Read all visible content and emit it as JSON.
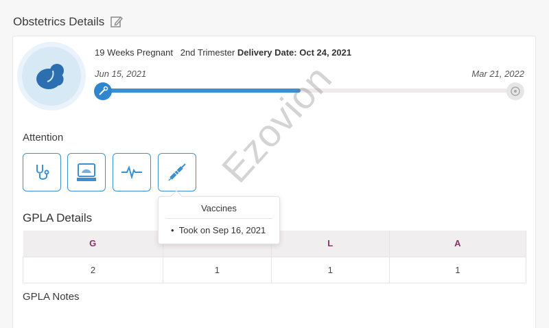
{
  "header": {
    "title": "Obstetrics Details",
    "edit_icon": "edit-icon"
  },
  "pregnancy": {
    "weeks_label": "19 Weeks Pregnant",
    "trimester_label": "2nd Trimester",
    "delivery_label": "Delivery Date: Oct 24, 2021",
    "start_date": "Jun 15, 2021",
    "end_date": "Mar 21, 2022",
    "progress_fraction": 0.48,
    "start_icon": "needle-icon",
    "end_icon": "baby-icon"
  },
  "attention": {
    "label": "Attention",
    "buttons": [
      {
        "icon": "stethoscope-icon"
      },
      {
        "icon": "ultrasound-monitor-icon"
      },
      {
        "icon": "heartbeat-icon"
      },
      {
        "icon": "syringe-icon"
      }
    ]
  },
  "vaccines_popover": {
    "title": "Vaccines",
    "items": [
      "Took on Sep 16, 2021"
    ]
  },
  "gpla": {
    "title": "GPLA Details",
    "headers": [
      "G",
      "",
      "L",
      "A"
    ],
    "values": [
      "2",
      "1",
      "1",
      "1"
    ],
    "notes_label": "GPLA Notes"
  },
  "watermark": "Ezovion",
  "colors": {
    "accent": "#3b8fd3",
    "header_text": "#8a2f6a",
    "table_header_bg": "#f1eef0"
  }
}
